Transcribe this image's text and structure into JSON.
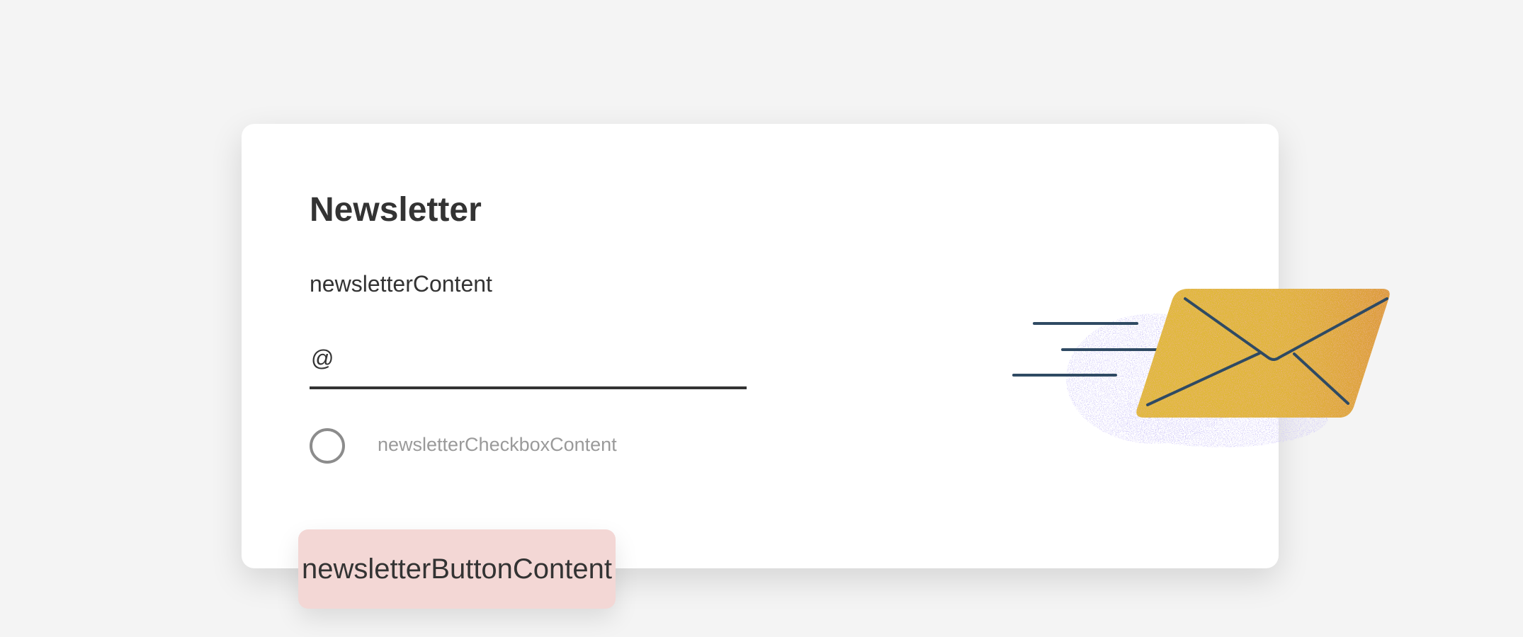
{
  "newsletter": {
    "title": "Newsletter",
    "content": "newsletterContent",
    "email": {
      "prefix": "@",
      "value": "",
      "placeholder": ""
    },
    "checkbox": {
      "label": "newsletterCheckboxContent",
      "checked": false
    },
    "button_label": "newsletterButtonContent"
  },
  "colors": {
    "background": "#f4f4f4",
    "card": "#ffffff",
    "text": "#333333",
    "muted_text": "#9a9a9a",
    "button": "#f3d7d5",
    "envelope": "#e0b93a",
    "envelope_lines": "#2f4a63",
    "speckle": "#a59af2"
  },
  "illustration": {
    "icon": "envelope-icon"
  }
}
